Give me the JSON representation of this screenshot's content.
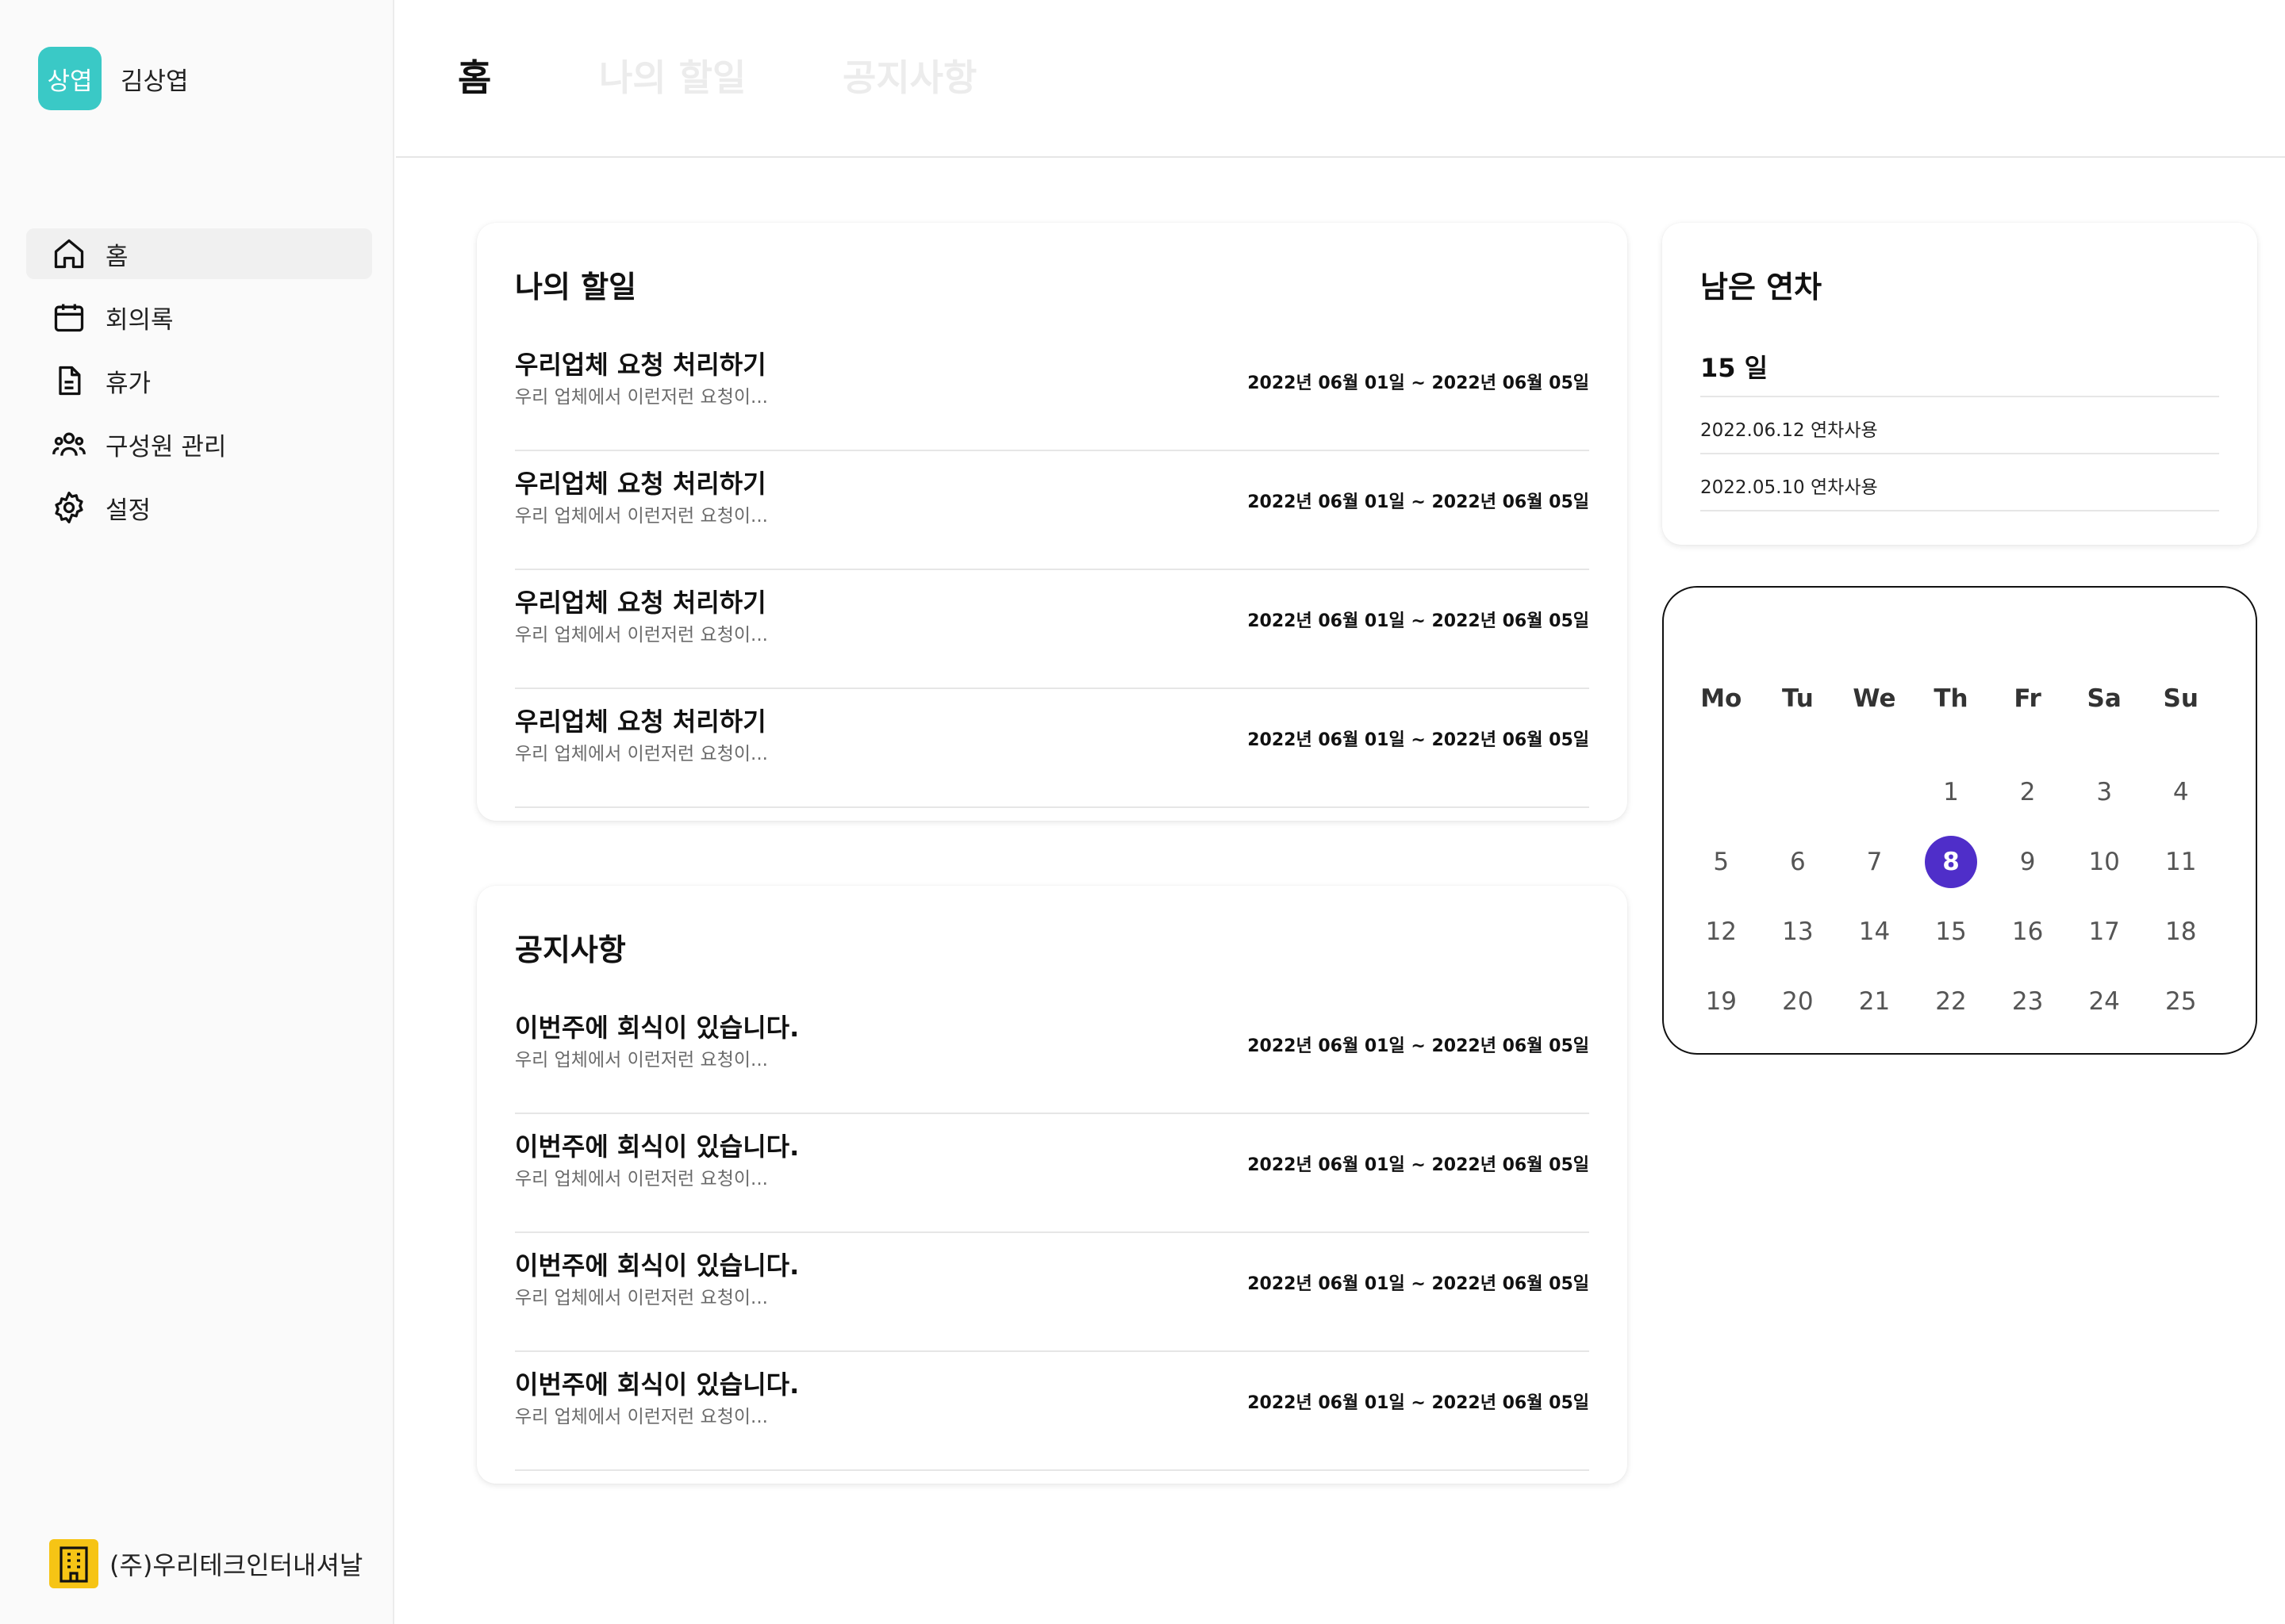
{
  "profile": {
    "avatar_text": "상엽",
    "name": "김상엽",
    "avatar_color": "#3ac9c6"
  },
  "sidebar": {
    "items": [
      {
        "label": "홈",
        "icon": "home-icon",
        "active": true
      },
      {
        "label": "회의록",
        "icon": "calendar-icon"
      },
      {
        "label": "휴가",
        "icon": "document-icon"
      },
      {
        "label": "구성원 관리",
        "icon": "users-icon"
      },
      {
        "label": "설정",
        "icon": "gear-icon"
      }
    ],
    "company": {
      "name": "(주)우리테크인터내셔날",
      "icon": "building-icon",
      "icon_color": "#f6c415"
    }
  },
  "tabs": [
    {
      "label": "홈",
      "active": true
    },
    {
      "label": "나의 할일",
      "active": false
    },
    {
      "label": "공지사항",
      "active": false
    }
  ],
  "todo": {
    "title": "나의 할일",
    "items": [
      {
        "title": "우리업체 요청 처리하기",
        "desc": "우리 업체에서 이런저런 요청이...",
        "date": "2022년 06월 01일 ~ 2022년 06월 05일"
      },
      {
        "title": "우리업체 요청 처리하기",
        "desc": "우리 업체에서 이런저런 요청이...",
        "date": "2022년 06월 01일 ~ 2022년 06월 05일"
      },
      {
        "title": "우리업체 요청 처리하기",
        "desc": "우리 업체에서 이런저런 요청이...",
        "date": "2022년 06월 01일 ~ 2022년 06월 05일"
      },
      {
        "title": "우리업체 요청 처리하기",
        "desc": "우리 업체에서 이런저런 요청이...",
        "date": "2022년 06월 01일 ~ 2022년 06월 05일"
      }
    ]
  },
  "notices": {
    "title": "공지사항",
    "items": [
      {
        "title": "이번주에 회식이 있습니다.",
        "desc": "우리 업체에서 이런저런 요청이...",
        "date": "2022년 06월 01일 ~ 2022년 06월 05일"
      },
      {
        "title": "이번주에 회식이 있습니다.",
        "desc": "우리 업체에서 이런저런 요청이...",
        "date": "2022년 06월 01일 ~ 2022년 06월 05일"
      },
      {
        "title": "이번주에 회식이 있습니다.",
        "desc": "우리 업체에서 이런저런 요청이...",
        "date": "2022년 06월 01일 ~ 2022년 06월 05일"
      },
      {
        "title": "이번주에 회식이 있습니다.",
        "desc": "우리 업체에서 이런저런 요청이...",
        "date": "2022년 06월 01일 ~ 2022년 06월 05일"
      }
    ]
  },
  "leave": {
    "title": "남은 연차",
    "remaining": "15 일",
    "history": [
      "2022.06.12 연차사용",
      "2022.05.10 연차사용"
    ]
  },
  "calendar": {
    "weekdays": [
      "Mo",
      "Tu",
      "We",
      "Th",
      "Fr",
      "Sa",
      "Su"
    ],
    "weeks": [
      [
        "",
        "",
        "",
        "1",
        "2",
        "3",
        "4"
      ],
      [
        "5",
        "6",
        "7",
        "8",
        "9",
        "10",
        "11"
      ],
      [
        "12",
        "13",
        "14",
        "15",
        "16",
        "17",
        "18"
      ],
      [
        "19",
        "20",
        "21",
        "22",
        "23",
        "24",
        "25"
      ]
    ],
    "selected": "8",
    "selected_color": "#4f2ec9"
  }
}
